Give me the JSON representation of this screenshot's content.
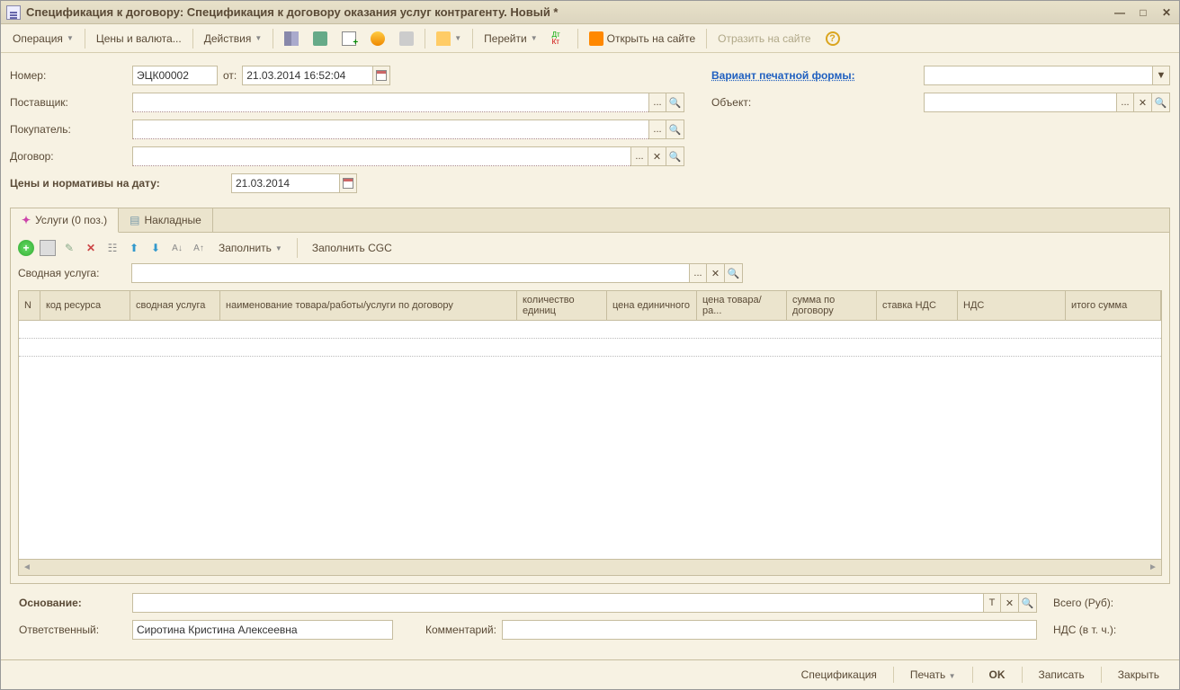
{
  "title": "Спецификация к договору: Спецификация к договору оказания услуг контрагенту. Новый *",
  "toolbar": {
    "operation": "Операция",
    "prices_currency": "Цены и валюта...",
    "actions": "Действия",
    "goto": "Перейти",
    "open_site": "Открыть на сайте",
    "reflect_site": "Отразить на сайте"
  },
  "fields": {
    "number_label": "Номер:",
    "number_value": "ЭЦК00002",
    "from_label": "от:",
    "date_value": "21.03.2014 16:52:04",
    "supplier_label": "Поставщик:",
    "buyer_label": "Покупатель:",
    "contract_label": "Договор:",
    "prices_date_label": "Цены и нормативы на дату:",
    "prices_date_value": "21.03.2014",
    "print_form_label": "Вариант печатной формы:",
    "object_label": "Объект:"
  },
  "tabs": {
    "services": "Услуги (0 поз.)",
    "invoices": "Накладные"
  },
  "tab_tools": {
    "fill": "Заполнить",
    "fill_cgc": "Заполнить CGC",
    "summary_service_label": "Сводная услуга:"
  },
  "grid_columns": {
    "n": "N",
    "resource_code": "код ресурса",
    "summary_service": "сводная услуга",
    "name": "наименование товара/работы/услуги по договору",
    "qty": "количество единиц",
    "unit_price": "цена единичного",
    "goods_price": "цена товара/ра...",
    "contract_sum": "сумма по договору",
    "vat_rate": "ставка НДС",
    "vat": "НДС",
    "total_sum": "итого сумма"
  },
  "footer": {
    "basis_label": "Основание:",
    "responsible_label": "Ответственный:",
    "responsible_value": "Сиротина Кристина Алексеевна",
    "comment_label": "Комментарий:",
    "total_label": "Всего (Руб):",
    "vat_incl_label": "НДС (в т. ч.):"
  },
  "bottom": {
    "spec": "Спецификация",
    "print": "Печать",
    "ok": "OK",
    "save": "Записать",
    "close": "Закрыть"
  }
}
